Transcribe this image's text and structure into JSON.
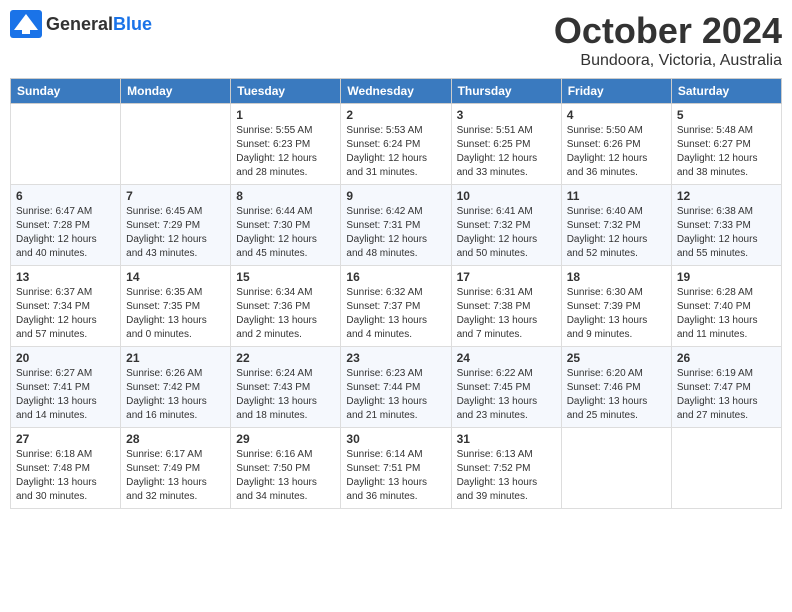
{
  "header": {
    "logo_general": "General",
    "logo_blue": "Blue",
    "month": "October 2024",
    "location": "Bundoora, Victoria, Australia"
  },
  "columns": [
    "Sunday",
    "Monday",
    "Tuesday",
    "Wednesday",
    "Thursday",
    "Friday",
    "Saturday"
  ],
  "weeks": [
    [
      {
        "day": "",
        "content": ""
      },
      {
        "day": "",
        "content": ""
      },
      {
        "day": "1",
        "content": "Sunrise: 5:55 AM\nSunset: 6:23 PM\nDaylight: 12 hours and 28 minutes."
      },
      {
        "day": "2",
        "content": "Sunrise: 5:53 AM\nSunset: 6:24 PM\nDaylight: 12 hours and 31 minutes."
      },
      {
        "day": "3",
        "content": "Sunrise: 5:51 AM\nSunset: 6:25 PM\nDaylight: 12 hours and 33 minutes."
      },
      {
        "day": "4",
        "content": "Sunrise: 5:50 AM\nSunset: 6:26 PM\nDaylight: 12 hours and 36 minutes."
      },
      {
        "day": "5",
        "content": "Sunrise: 5:48 AM\nSunset: 6:27 PM\nDaylight: 12 hours and 38 minutes."
      }
    ],
    [
      {
        "day": "6",
        "content": "Sunrise: 6:47 AM\nSunset: 7:28 PM\nDaylight: 12 hours and 40 minutes."
      },
      {
        "day": "7",
        "content": "Sunrise: 6:45 AM\nSunset: 7:29 PM\nDaylight: 12 hours and 43 minutes."
      },
      {
        "day": "8",
        "content": "Sunrise: 6:44 AM\nSunset: 7:30 PM\nDaylight: 12 hours and 45 minutes."
      },
      {
        "day": "9",
        "content": "Sunrise: 6:42 AM\nSunset: 7:31 PM\nDaylight: 12 hours and 48 minutes."
      },
      {
        "day": "10",
        "content": "Sunrise: 6:41 AM\nSunset: 7:32 PM\nDaylight: 12 hours and 50 minutes."
      },
      {
        "day": "11",
        "content": "Sunrise: 6:40 AM\nSunset: 7:32 PM\nDaylight: 12 hours and 52 minutes."
      },
      {
        "day": "12",
        "content": "Sunrise: 6:38 AM\nSunset: 7:33 PM\nDaylight: 12 hours and 55 minutes."
      }
    ],
    [
      {
        "day": "13",
        "content": "Sunrise: 6:37 AM\nSunset: 7:34 PM\nDaylight: 12 hours and 57 minutes."
      },
      {
        "day": "14",
        "content": "Sunrise: 6:35 AM\nSunset: 7:35 PM\nDaylight: 13 hours and 0 minutes."
      },
      {
        "day": "15",
        "content": "Sunrise: 6:34 AM\nSunset: 7:36 PM\nDaylight: 13 hours and 2 minutes."
      },
      {
        "day": "16",
        "content": "Sunrise: 6:32 AM\nSunset: 7:37 PM\nDaylight: 13 hours and 4 minutes."
      },
      {
        "day": "17",
        "content": "Sunrise: 6:31 AM\nSunset: 7:38 PM\nDaylight: 13 hours and 7 minutes."
      },
      {
        "day": "18",
        "content": "Sunrise: 6:30 AM\nSunset: 7:39 PM\nDaylight: 13 hours and 9 minutes."
      },
      {
        "day": "19",
        "content": "Sunrise: 6:28 AM\nSunset: 7:40 PM\nDaylight: 13 hours and 11 minutes."
      }
    ],
    [
      {
        "day": "20",
        "content": "Sunrise: 6:27 AM\nSunset: 7:41 PM\nDaylight: 13 hours and 14 minutes."
      },
      {
        "day": "21",
        "content": "Sunrise: 6:26 AM\nSunset: 7:42 PM\nDaylight: 13 hours and 16 minutes."
      },
      {
        "day": "22",
        "content": "Sunrise: 6:24 AM\nSunset: 7:43 PM\nDaylight: 13 hours and 18 minutes."
      },
      {
        "day": "23",
        "content": "Sunrise: 6:23 AM\nSunset: 7:44 PM\nDaylight: 13 hours and 21 minutes."
      },
      {
        "day": "24",
        "content": "Sunrise: 6:22 AM\nSunset: 7:45 PM\nDaylight: 13 hours and 23 minutes."
      },
      {
        "day": "25",
        "content": "Sunrise: 6:20 AM\nSunset: 7:46 PM\nDaylight: 13 hours and 25 minutes."
      },
      {
        "day": "26",
        "content": "Sunrise: 6:19 AM\nSunset: 7:47 PM\nDaylight: 13 hours and 27 minutes."
      }
    ],
    [
      {
        "day": "27",
        "content": "Sunrise: 6:18 AM\nSunset: 7:48 PM\nDaylight: 13 hours and 30 minutes."
      },
      {
        "day": "28",
        "content": "Sunrise: 6:17 AM\nSunset: 7:49 PM\nDaylight: 13 hours and 32 minutes."
      },
      {
        "day": "29",
        "content": "Sunrise: 6:16 AM\nSunset: 7:50 PM\nDaylight: 13 hours and 34 minutes."
      },
      {
        "day": "30",
        "content": "Sunrise: 6:14 AM\nSunset: 7:51 PM\nDaylight: 13 hours and 36 minutes."
      },
      {
        "day": "31",
        "content": "Sunrise: 6:13 AM\nSunset: 7:52 PM\nDaylight: 13 hours and 39 minutes."
      },
      {
        "day": "",
        "content": ""
      },
      {
        "day": "",
        "content": ""
      }
    ]
  ]
}
